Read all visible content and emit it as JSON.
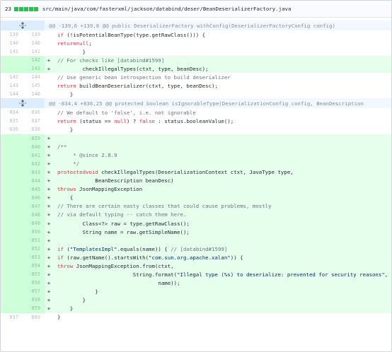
{
  "file": {
    "change_count": "23",
    "diffstat_blocks": 5,
    "path": "src/main/java/com/fasterxml/jackson/databind/deser/BeanDeserializerFactory.java",
    "expand_icon": "unfold-icon"
  },
  "rows": [
    {
      "type": "hunk",
      "text": "@@ -139,6 +139,8 @@ public DeserializerFactory withConfig(DeserializerFactoryConfig config)"
    },
    {
      "type": "ctx",
      "old": "139",
      "new": "139",
      "text": "        if (!isPotentialBeanType(type.getRawClass())) {"
    },
    {
      "type": "ctx",
      "old": "140",
      "new": "140",
      "text": "            return null;"
    },
    {
      "type": "ctx",
      "old": "141",
      "new": "141",
      "text": "        }"
    },
    {
      "type": "add",
      "old": "",
      "new": "142",
      "text": "        // For checks like [databind#1599]"
    },
    {
      "type": "add",
      "old": "",
      "new": "143",
      "text": "        checkIllegalTypes(ctxt, type, beanDesc);"
    },
    {
      "type": "ctx",
      "old": "142",
      "new": "144",
      "text": "        // Use generic bean introspection to build deserializer"
    },
    {
      "type": "ctx",
      "old": "143",
      "new": "145",
      "text": "        return buildBeanDeserializer(ctxt, type, beanDesc);"
    },
    {
      "type": "ctx",
      "old": "144",
      "new": "146",
      "text": "    }"
    },
    {
      "type": "hunk",
      "text": "@@ -834,4 +836,25 @@ protected boolean isIgnorableType(DeserializationConfig config, BeanDescription"
    },
    {
      "type": "ctx",
      "old": "834",
      "new": "836",
      "text": "        // We default to 'false', i.e. not ignorable"
    },
    {
      "type": "ctx",
      "old": "835",
      "new": "837",
      "text": "        return (status == null) ? false : status.booleanValue();"
    },
    {
      "type": "ctx",
      "old": "836",
      "new": "838",
      "text": "    }"
    },
    {
      "type": "add",
      "old": "",
      "new": "839",
      "text": ""
    },
    {
      "type": "add",
      "old": "",
      "new": "840",
      "text": "    /**"
    },
    {
      "type": "add",
      "old": "",
      "new": "841",
      "text": "     * @since 2.8.9"
    },
    {
      "type": "add",
      "old": "",
      "new": "842",
      "text": "     */"
    },
    {
      "type": "add",
      "old": "",
      "new": "843",
      "text": "    protected void checkIllegalTypes(DeserializationContext ctxt, JavaType type,"
    },
    {
      "type": "add",
      "old": "",
      "new": "844",
      "text": "            BeanDescription beanDesc)"
    },
    {
      "type": "add",
      "old": "",
      "new": "845",
      "text": "        throws JsonMappingException"
    },
    {
      "type": "add",
      "old": "",
      "new": "846",
      "text": "    {"
    },
    {
      "type": "add",
      "old": "",
      "new": "847",
      "text": "        // There are certain nasty classes that could cause problems, mostly"
    },
    {
      "type": "add",
      "old": "",
      "new": "848",
      "text": "        // via default typing -- catch them here."
    },
    {
      "type": "add",
      "old": "",
      "new": "849",
      "text": "        Class<?> raw = type.getRawClass();"
    },
    {
      "type": "add",
      "old": "",
      "new": "850",
      "text": "        String name = raw.getSimpleName();"
    },
    {
      "type": "add",
      "old": "",
      "new": "851",
      "text": ""
    },
    {
      "type": "add",
      "old": "",
      "new": "852",
      "text": "        if (\"TemplatesImpl\".equals(name)) { // [databind#1599]"
    },
    {
      "type": "add",
      "old": "",
      "new": "853",
      "text": "            if (raw.getName().startsWith(\"com.sun.org.apache.xalan\")) {"
    },
    {
      "type": "add",
      "old": "",
      "new": "854",
      "text": "                throw JsonMappingException.from(ctxt,"
    },
    {
      "type": "add",
      "old": "",
      "new": "855",
      "text": "                        String.format(\"Illegal type (%s) to deserialize: prevented for security reasons\","
    },
    {
      "type": "add",
      "old": "",
      "new": "856",
      "text": "                                name));"
    },
    {
      "type": "add",
      "old": "",
      "new": "857",
      "text": "            }"
    },
    {
      "type": "add",
      "old": "",
      "new": "858",
      "text": "        }"
    },
    {
      "type": "add",
      "old": "",
      "new": "859",
      "text": "    }"
    },
    {
      "type": "ctx",
      "old": "837",
      "new": "860",
      "text": "}"
    }
  ],
  "colors": {
    "add_bg": "#e6ffed",
    "add_num_bg": "#cdffd8",
    "hunk_bg": "#f1f8ff",
    "diffstat_green": "#2cbe4e"
  }
}
